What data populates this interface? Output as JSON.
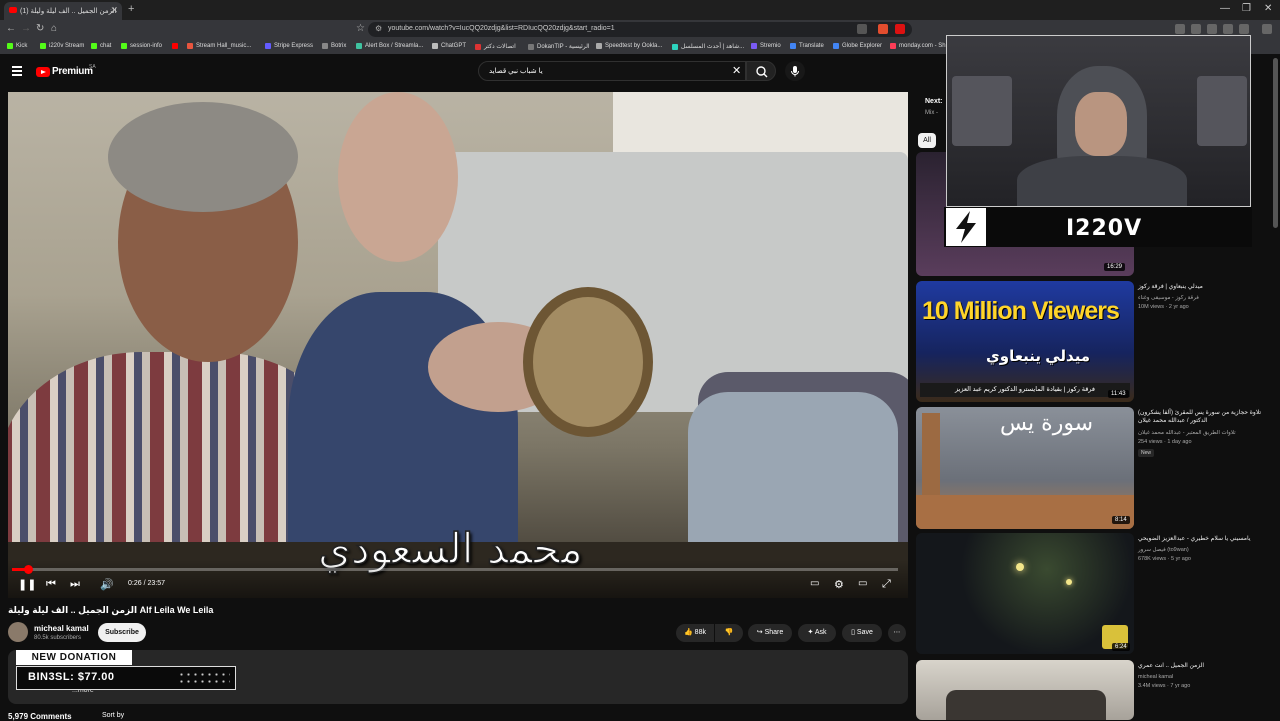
{
  "browser": {
    "tab_title": "(1) الزمن الجميل .. الف ليلة وليلة",
    "url": "youtube.com/watch?v=IucQQ20zdjg&list=RDIucQQ20zdjg&start_radio=1",
    "bookmarks": [
      {
        "label": "Kick",
        "color": "#53fc18"
      },
      {
        "label": "i220v Stream",
        "color": "#53fc18"
      },
      {
        "label": "chat",
        "color": "#53fc18"
      },
      {
        "label": "session-info",
        "color": "#53fc18"
      },
      {
        "label": "",
        "color": "#ff0000"
      },
      {
        "label": "Stream Hall_music...",
        "color": "#e8553e"
      },
      {
        "label": "Stripe Express",
        "color": "#635bff"
      },
      {
        "label": "Botrix",
        "color": "#888888"
      },
      {
        "label": "Alert Box / Streamla...",
        "color": "#3fc3a0"
      },
      {
        "label": "ChatGPT",
        "color": "#bbbbbb"
      },
      {
        "label": "اتصالات دكتر",
        "color": "#d33"
      },
      {
        "label": "DokanTIP - الرئيسية",
        "color": "#777"
      },
      {
        "label": "Speedtest by Ookla...",
        "color": "#aaa"
      },
      {
        "label": "شاهد | أحدث المسلسل...",
        "color": "#2dd4bf"
      },
      {
        "label": "Stremio",
        "color": "#7b5bf5"
      },
      {
        "label": "Translate",
        "color": "#4285f4"
      },
      {
        "label": "Globe Explorer",
        "color": "#4285f4"
      },
      {
        "label": "monday.com - Sh...",
        "color": "#ff3d57"
      }
    ]
  },
  "youtube": {
    "premium_label": "Premium",
    "premium_region": "SA",
    "search_value": "يا شباب نبي قصايد"
  },
  "player": {
    "subtitle": "محمد السعودي",
    "timecode": "0:26 / 23:57",
    "progress_fraction": 0.018
  },
  "video": {
    "title": "الزمن الجميل .. الف ليلة وليلة Alf Leila We Leila",
    "channel": "micheal kamal",
    "subscribers": "80.5k subscribers",
    "subscribe_label": "Subscribe",
    "likes": "88k",
    "share_label": "Share",
    "ask_label": "Ask",
    "save_label": "Save",
    "more_label": "...more",
    "comments_count": "5,979 Comments",
    "sort_label": "Sort by"
  },
  "donation": {
    "header": "NEW DONATION",
    "text": "BIN3SL: $77.00"
  },
  "sidebar": {
    "next_label": "Next: ",
    "mix_label": "Mix - ",
    "chip_all": "All",
    "videos": [
      {
        "title": "",
        "meta1": "",
        "meta2": "",
        "duration": "16:29",
        "color": "#3d2f4a"
      },
      {
        "title": "ميدلي ينبعاوي | فرقة ركوز",
        "meta1": "فرقة ركوز - موسيقى وغناء",
        "meta2": "10M views · 2 yr ago",
        "duration": "11:43",
        "thumb_text": "10 Million Viewers",
        "thumb_sub": "ميدلي ينبعاوي",
        "thumb_caption": "فرقة ركوز | بقيادة المايسترو الدكتور كريم عبد العزيز",
        "color": "#1b2f7a"
      },
      {
        "title": "(ألفا يشكرون) تلاوة حجازية من سورة يس للمقرئ الدكتور / عبدالله محمد غيلان",
        "meta1": "تلاوات الطريق المعتبر - عبدالله محمد غيلان",
        "meta2": "254 views · 1 day ago",
        "badge": "New",
        "duration": "8:14",
        "thumb_text": "سورة يس",
        "color": "#7a7f88"
      },
      {
        "title": "يامسيني يا سلام خطيري - عبدالعزيز الضويحي",
        "meta1": "فيصل سرور (to9wan)",
        "meta2": "678K views · 5 yr ago",
        "duration": "6:24",
        "color": "#1a1d22"
      },
      {
        "title": "الزمن الجميل .. انت عمري",
        "meta1": "micheal kamal",
        "meta2": "3.4M views · 7 yr ago",
        "duration": "",
        "color": "#c9c6bf"
      }
    ]
  },
  "streamer": {
    "name": "I220V"
  }
}
